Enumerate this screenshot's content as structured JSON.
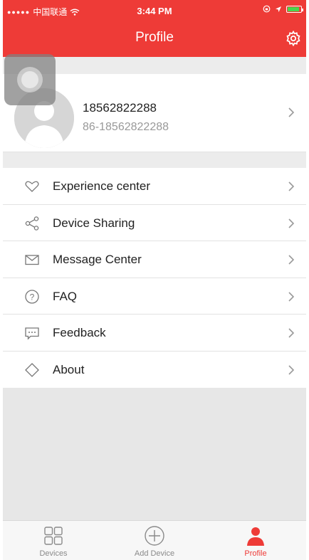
{
  "status_bar": {
    "signal": "●●●●●",
    "carrier": "中国联通",
    "time": "3:44 PM"
  },
  "nav": {
    "title": "Profile",
    "settings_icon": "gear-icon"
  },
  "profile": {
    "phone": "18562822288",
    "account": "86-18562822288",
    "avatar_icon": "user-silhouette-icon"
  },
  "menu": {
    "items": [
      {
        "label": "Experience center",
        "icon": "heart-icon"
      },
      {
        "label": "Device Sharing",
        "icon": "share-icon"
      },
      {
        "label": "Message Center",
        "icon": "envelope-icon"
      },
      {
        "label": "FAQ",
        "icon": "question-icon"
      },
      {
        "label": "Feedback",
        "icon": "chat-bubble-icon"
      },
      {
        "label": "About",
        "icon": "diamond-icon"
      }
    ]
  },
  "tabs": {
    "items": [
      {
        "label": "Devices",
        "icon": "grid-icon",
        "active": false
      },
      {
        "label": "Add Device",
        "icon": "plus-circle-icon",
        "active": false
      },
      {
        "label": "Profile",
        "icon": "person-icon",
        "active": true
      }
    ]
  },
  "colors": {
    "accent": "#ee3b37",
    "background": "#ececec",
    "text": "#222222",
    "muted": "#999999"
  }
}
